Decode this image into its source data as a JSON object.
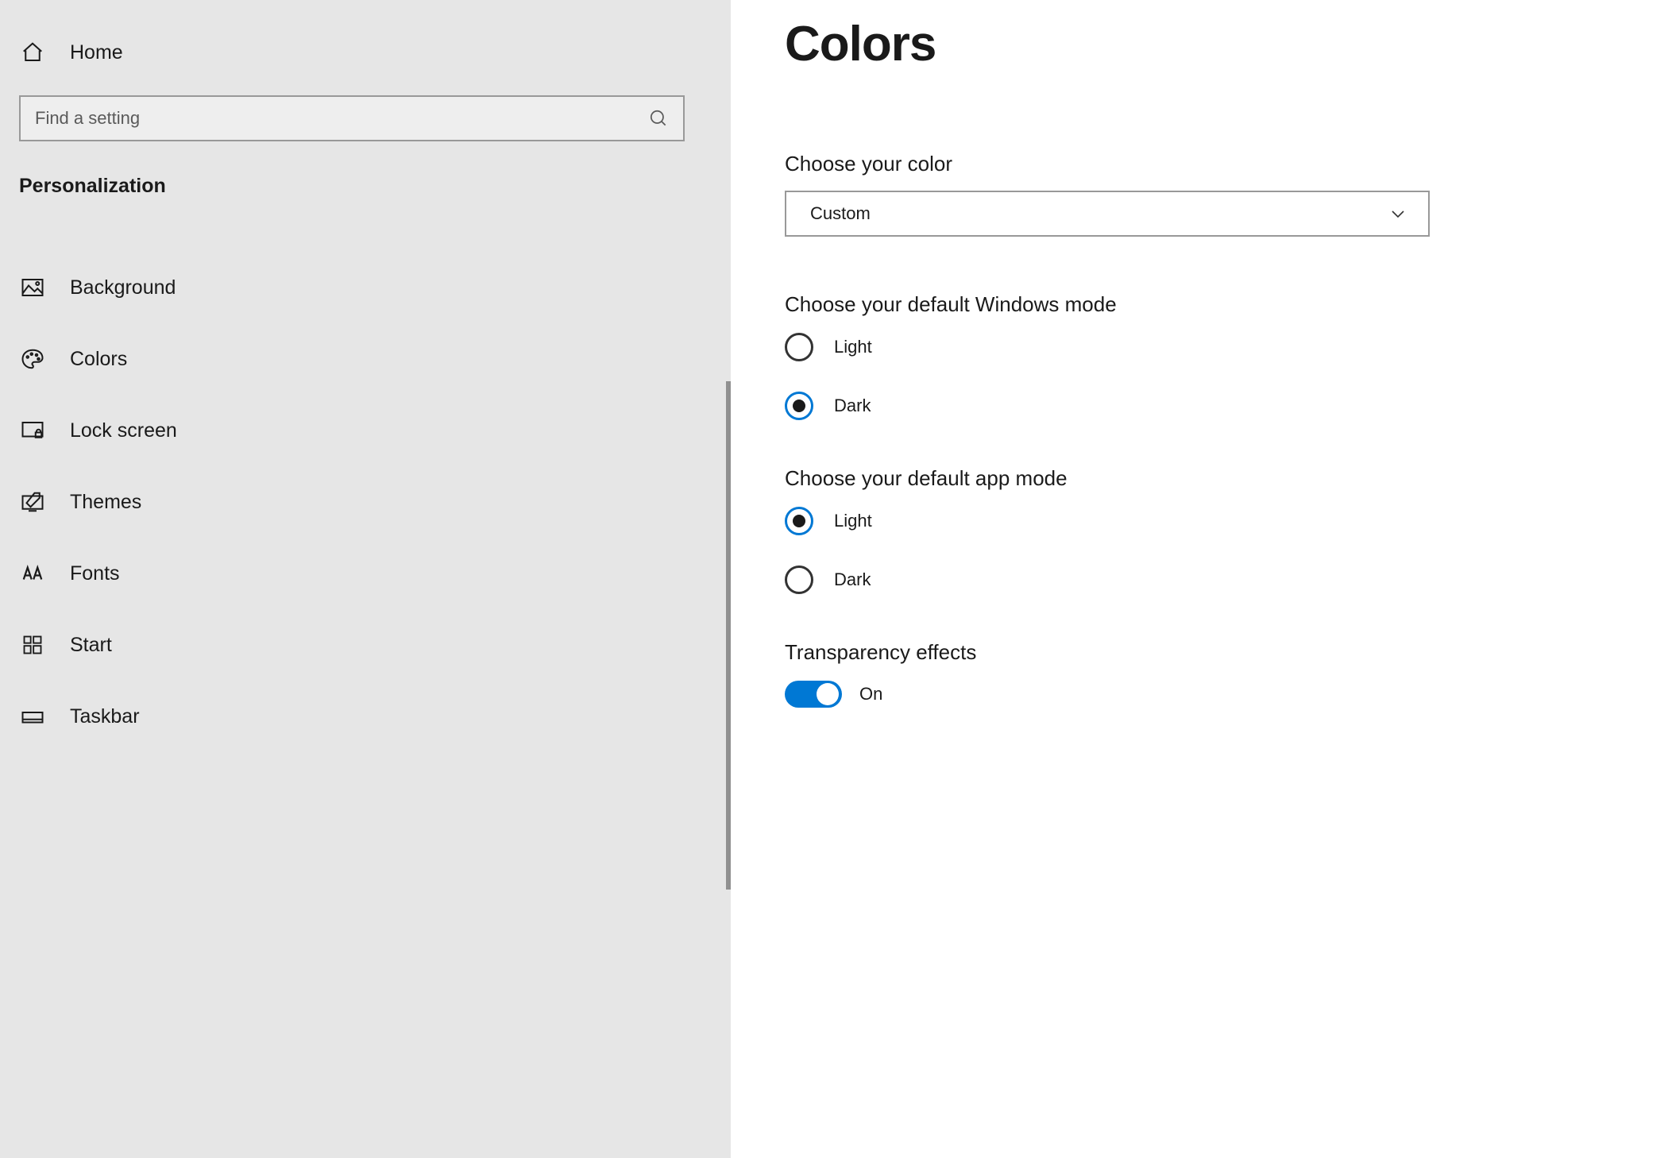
{
  "sidebar": {
    "home_label": "Home",
    "search_placeholder": "Find a setting",
    "group_label": "Personalization",
    "items": [
      {
        "label": "Background"
      },
      {
        "label": "Colors"
      },
      {
        "label": "Lock screen"
      },
      {
        "label": "Themes"
      },
      {
        "label": "Fonts"
      },
      {
        "label": "Start"
      },
      {
        "label": "Taskbar"
      }
    ]
  },
  "main": {
    "title": "Colors",
    "choose_color_label": "Choose your color",
    "color_dropdown_value": "Custom",
    "windows_mode": {
      "label": "Choose your default Windows mode",
      "options": [
        {
          "label": "Light",
          "selected": false
        },
        {
          "label": "Dark",
          "selected": true
        }
      ]
    },
    "app_mode": {
      "label": "Choose your default app mode",
      "options": [
        {
          "label": "Light",
          "selected": true
        },
        {
          "label": "Dark",
          "selected": false
        }
      ]
    },
    "transparency": {
      "label": "Transparency effects",
      "state_label": "On",
      "enabled": true
    }
  }
}
